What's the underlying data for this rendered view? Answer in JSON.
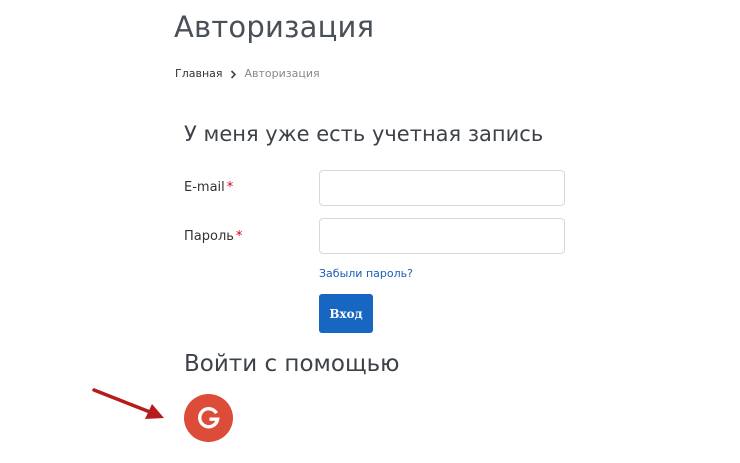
{
  "page": {
    "title": "Авторизация"
  },
  "breadcrumb": {
    "home": "Главная",
    "current": "Авторизация"
  },
  "login_form": {
    "heading": "У меня уже есть учетная запись",
    "email_label": "E-mail",
    "password_label": "Пароль",
    "required_mark": "*",
    "email_value": "",
    "password_value": "",
    "forgot_link": "Забыли пароль?",
    "submit_label": "Вход"
  },
  "social": {
    "heading": "Войти с помощью",
    "providers": [
      {
        "name": "google",
        "icon": "google-icon",
        "letter": "G",
        "color": "#dd4b39"
      }
    ]
  },
  "colors": {
    "accent": "#1766c2",
    "required": "#d0021b",
    "link": "#1a5fb4",
    "annotation_arrow": "#b71c1c"
  }
}
